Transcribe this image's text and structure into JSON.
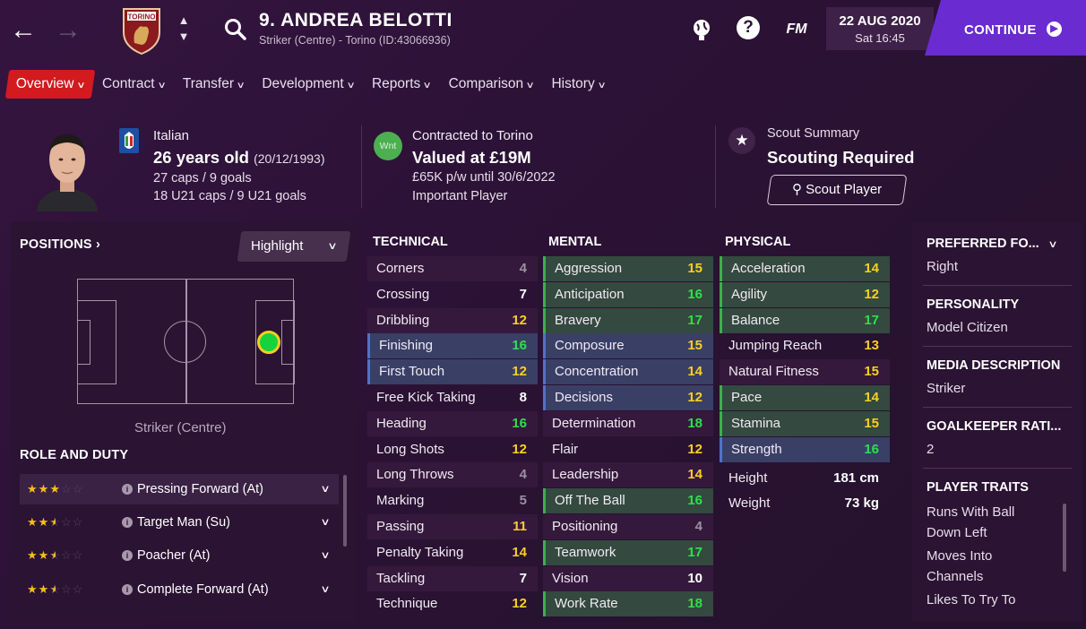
{
  "header": {
    "player_name": "9. ANDREA BELOTTI",
    "player_sub": "Striker (Centre) - Torino (ID:43066936)",
    "club_crest": "torino-crest",
    "date": "22 AUG 2020",
    "day_time": "Sat 16:45",
    "fm_label": "FM",
    "continue_label": "CONTINUE"
  },
  "tabs": [
    {
      "label": "Overview",
      "active": true
    },
    {
      "label": "Contract"
    },
    {
      "label": "Transfer"
    },
    {
      "label": "Development"
    },
    {
      "label": "Reports"
    },
    {
      "label": "Comparison"
    },
    {
      "label": "History"
    }
  ],
  "info": {
    "nationality": "Italian",
    "age": "26 years old",
    "dob": "(20/12/1993)",
    "caps": "27 caps / 9 goals",
    "u21_caps": "18 U21 caps / 9 U21 goals",
    "wnt_badge": "Wnt",
    "contract_to": "Contracted to Torino",
    "valued": "Valued at £19M",
    "wage": "£65K p/w until 30/6/2022",
    "status": "Important Player",
    "scout_summary_title": "Scout Summary",
    "scout_summary_value": "Scouting Required",
    "scout_button": "Scout Player"
  },
  "positions": {
    "title": "POSITIONS",
    "highlight_label": "Highlight",
    "position_label": "Striker (Centre)"
  },
  "roles": {
    "title": "ROLE AND DUTY",
    "items": [
      {
        "stars": 3,
        "name": "Pressing Forward (At)"
      },
      {
        "stars": 2.5,
        "name": "Target Man (Su)"
      },
      {
        "stars": 2.5,
        "name": "Poacher (At)"
      },
      {
        "stars": 2.5,
        "name": "Complete Forward (At)"
      }
    ]
  },
  "technical": {
    "title": "TECHNICAL",
    "items": [
      {
        "name": "Corners",
        "value": 4,
        "hl": "shade"
      },
      {
        "name": "Crossing",
        "value": 7,
        "hl": "plain"
      },
      {
        "name": "Dribbling",
        "value": 12,
        "hl": "shade"
      },
      {
        "name": "Finishing",
        "value": 16,
        "hl": "blue"
      },
      {
        "name": "First Touch",
        "value": 12,
        "hl": "blue"
      },
      {
        "name": "Free Kick Taking",
        "value": 8,
        "hl": "plain"
      },
      {
        "name": "Heading",
        "value": 16,
        "hl": "shade"
      },
      {
        "name": "Long Shots",
        "value": 12,
        "hl": "plain"
      },
      {
        "name": "Long Throws",
        "value": 4,
        "hl": "shade"
      },
      {
        "name": "Marking",
        "value": 5,
        "hl": "plain"
      },
      {
        "name": "Passing",
        "value": 11,
        "hl": "shade"
      },
      {
        "name": "Penalty Taking",
        "value": 14,
        "hl": "plain"
      },
      {
        "name": "Tackling",
        "value": 7,
        "hl": "shade"
      },
      {
        "name": "Technique",
        "value": 12,
        "hl": "plain"
      }
    ]
  },
  "mental": {
    "title": "MENTAL",
    "items": [
      {
        "name": "Aggression",
        "value": 15,
        "hl": "green"
      },
      {
        "name": "Anticipation",
        "value": 16,
        "hl": "green"
      },
      {
        "name": "Bravery",
        "value": 17,
        "hl": "green"
      },
      {
        "name": "Composure",
        "value": 15,
        "hl": "blue"
      },
      {
        "name": "Concentration",
        "value": 14,
        "hl": "blue"
      },
      {
        "name": "Decisions",
        "value": 12,
        "hl": "blue"
      },
      {
        "name": "Determination",
        "value": 18,
        "hl": "shade"
      },
      {
        "name": "Flair",
        "value": 12,
        "hl": "plain"
      },
      {
        "name": "Leadership",
        "value": 14,
        "hl": "shade"
      },
      {
        "name": "Off The Ball",
        "value": 16,
        "hl": "green"
      },
      {
        "name": "Positioning",
        "value": 4,
        "hl": "shade"
      },
      {
        "name": "Teamwork",
        "value": 17,
        "hl": "green"
      },
      {
        "name": "Vision",
        "value": 10,
        "hl": "shade"
      },
      {
        "name": "Work Rate",
        "value": 18,
        "hl": "green"
      }
    ]
  },
  "physical": {
    "title": "PHYSICAL",
    "items": [
      {
        "name": "Acceleration",
        "value": 14,
        "hl": "green"
      },
      {
        "name": "Agility",
        "value": 12,
        "hl": "green"
      },
      {
        "name": "Balance",
        "value": 17,
        "hl": "green"
      },
      {
        "name": "Jumping Reach",
        "value": 13,
        "hl": "plain"
      },
      {
        "name": "Natural Fitness",
        "value": 15,
        "hl": "shade"
      },
      {
        "name": "Pace",
        "value": 14,
        "hl": "green"
      },
      {
        "name": "Stamina",
        "value": 15,
        "hl": "green"
      },
      {
        "name": "Strength",
        "value": 16,
        "hl": "blue"
      }
    ],
    "height_label": "Height",
    "height_value": "181 cm",
    "weight_label": "Weight",
    "weight_value": "73 kg"
  },
  "right_panel": {
    "preferred_foot_title": "PREFERRED FO...",
    "preferred_foot_value": "Right",
    "personality_title": "PERSONALITY",
    "personality_value": "Model Citizen",
    "media_title": "MEDIA DESCRIPTION",
    "media_value": "Striker",
    "gk_title": "GOALKEEPER RATI...",
    "gk_value": "2",
    "traits_title": "PLAYER TRAITS",
    "traits": [
      "Runs With Ball",
      "Down Left",
      "Moves Into",
      "Channels",
      "Likes To Try To"
    ]
  },
  "colors": {
    "background": "#2c1236",
    "accent_red": "#d21a1f",
    "continue_purple": "#6a2bd1",
    "attr_great": "#2ee04c",
    "attr_good": "#f8d023",
    "attr_low": "#9d8fa3"
  }
}
